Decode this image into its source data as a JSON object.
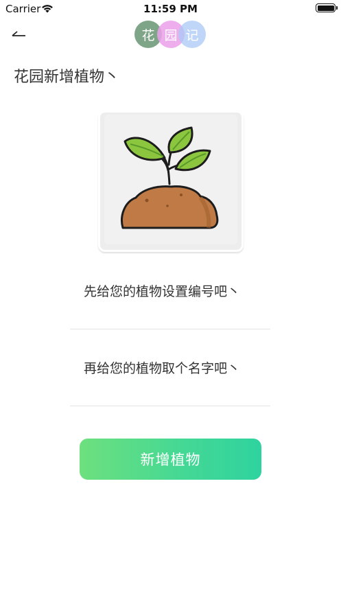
{
  "status_bar": {
    "carrier": "Carrier",
    "time": "11:59 PM",
    "wifi_icon": "wifi-icon",
    "battery_icon": "battery-icon"
  },
  "nav": {
    "back_icon": "back-arrow-icon",
    "logo_chars": [
      "花",
      "园",
      "记"
    ]
  },
  "page": {
    "title": "花园新增植物丶"
  },
  "plant_image": {
    "icon": "sprout-in-soil-icon",
    "colors": {
      "leaf": "#8cc63f",
      "soil": "#c07a45",
      "background": "#f1f1f1"
    }
  },
  "form": {
    "number_field": {
      "value": "",
      "placeholder": "先给您的植物设置编号吧丶"
    },
    "name_field": {
      "value": "",
      "placeholder": "再给您的植物取个名字吧丶"
    },
    "submit_label": "新增植物"
  },
  "colors": {
    "button_gradient_start": "#6ee07e",
    "button_gradient_end": "#2fd39f",
    "divider": "#e3e3e3"
  }
}
